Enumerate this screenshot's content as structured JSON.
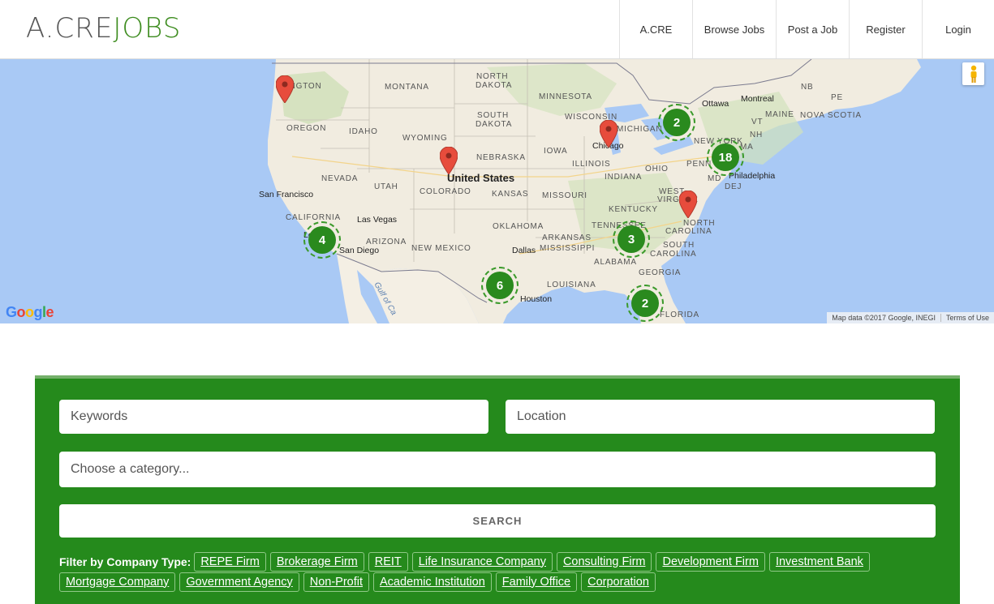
{
  "header": {
    "logo_part1": "A.CRE",
    "logo_part2": "JOBS",
    "nav": [
      "A.CRE",
      "Browse Jobs",
      "Post a Job",
      "Register",
      "Login"
    ]
  },
  "map": {
    "labels": {
      "washington": "HINGTON",
      "montana": "MONTANA",
      "north_dakota_1": "NORTH",
      "north_dakota_2": "DAKOTA",
      "minnesota": "MINNESOTA",
      "south_dakota_1": "SOUTH",
      "south_dakota_2": "DAKOTA",
      "wisconsin": "WISCONSIN",
      "michigan": "MICHIGAN",
      "oregon": "OREGON",
      "idaho": "IDAHO",
      "wyoming": "WYOMING",
      "nebraska": "NEBRASKA",
      "iowa": "IOWA",
      "illinois": "ILLINOIS",
      "indiana": "INDIANA",
      "ohio": "OHIO",
      "nevada": "NEVADA",
      "utah": "UTAH",
      "colorado": "COLORADO",
      "kansas": "KANSAS",
      "missouri": "MISSOURI",
      "california": "CALIFORNIA",
      "arizona": "ARIZONA",
      "new_mexico": "NEW MEXICO",
      "oklahoma": "OKLAHOMA",
      "arkansas": "ARKANSAS",
      "tennessee": "TENNESSEE",
      "kentucky": "KENTUCKY",
      "mississippi": "MISSISSIPPI",
      "alabama": "ALABAMA",
      "georgia": "GEORGIA",
      "louisiana": "LOUISIANA",
      "florida": "FLORIDA",
      "west_virginia": "WEST",
      "virginia": "VIRGINIA",
      "north_carolina_1": "NORTH",
      "north_carolina_2": "CAROLINA",
      "south_carolina_1": "SOUTH",
      "south_carolina_2": "CAROLINA",
      "new_york": "NEW YORK",
      "penn": "PENN",
      "md": "MD",
      "dej": "DEJ",
      "vt": "VT",
      "nh": "NH",
      "ma": "MA",
      "maine": "MAINE",
      "nova_scotia": "NOVA SCOTIA",
      "nb": "NB",
      "pe": "PE",
      "united_states": "United States",
      "san_francisco": "San Francisco",
      "las_vegas": "Las Vegas",
      "san_diego": "San Diego",
      "los_angeles": "Los",
      "dallas": "Dallas",
      "houston": "Houston",
      "chicago": "Chicago",
      "philadelphia": "Philadelphia",
      "ottawa": "Ottawa",
      "montreal": "Montreal",
      "gulf": "Gulf of Ca"
    },
    "clusters": [
      {
        "count": "2"
      },
      {
        "count": "18"
      },
      {
        "count": "4"
      },
      {
        "count": "3"
      },
      {
        "count": "6"
      },
      {
        "count": "2"
      }
    ],
    "attribution": "Map data ©2017 Google, INEGI",
    "terms": "Terms of Use",
    "google": "Google"
  },
  "search": {
    "keywords_placeholder": "Keywords",
    "location_placeholder": "Location",
    "category_placeholder": "Choose a category...",
    "button": "SEARCH",
    "filter_label": "Filter by Company Type:",
    "company_types_row1": [
      "REPE Firm",
      "Brokerage Firm",
      "REIT",
      "Life Insurance Company",
      "Consulting Firm",
      "Development Firm",
      "Investment Bank"
    ],
    "company_types_row2": [
      "Mortgage Company",
      "Government Agency",
      "Non-Profit",
      "Academic Institution",
      "Family Office",
      "Corporation"
    ]
  },
  "colors": {
    "brand_green": "#258a1c",
    "logo_green": "#3d8c1f",
    "pin_red": "#e74c3c",
    "water": "#a9c9f5",
    "land": "#f2efe6"
  }
}
